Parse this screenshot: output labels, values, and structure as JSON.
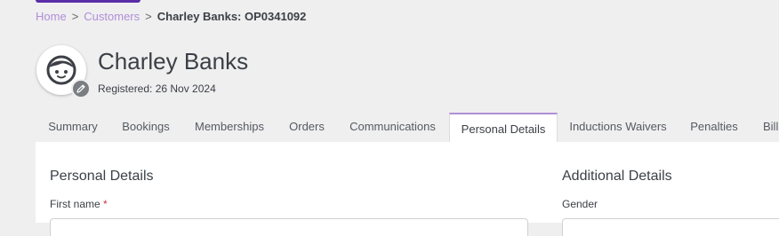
{
  "breadcrumb": {
    "home": "Home",
    "customers": "Customers",
    "separator": ">",
    "current": "Charley Banks: OP0341092"
  },
  "customer": {
    "name": "Charley Banks",
    "registered": "Registered: 26 Nov 2024"
  },
  "tabs": [
    {
      "label": "Summary",
      "active": false
    },
    {
      "label": "Bookings",
      "active": false
    },
    {
      "label": "Memberships",
      "active": false
    },
    {
      "label": "Orders",
      "active": false
    },
    {
      "label": "Communications",
      "active": false
    },
    {
      "label": "Personal Details",
      "active": true
    },
    {
      "label": "Inductions Waivers",
      "active": false
    },
    {
      "label": "Penalties",
      "active": false
    },
    {
      "label": "Bill",
      "active": false
    }
  ],
  "personal_details": {
    "title": "Personal Details",
    "first_name_label": "First name",
    "required_marker": "*"
  },
  "additional_details": {
    "title": "Additional Details",
    "gender_label": "Gender"
  },
  "colors": {
    "accent": "#b08ed6",
    "brand": "#5a2ea6",
    "required": "#d0323a"
  },
  "icons": {
    "avatar": "user-face-icon",
    "edit": "pencil-icon"
  }
}
